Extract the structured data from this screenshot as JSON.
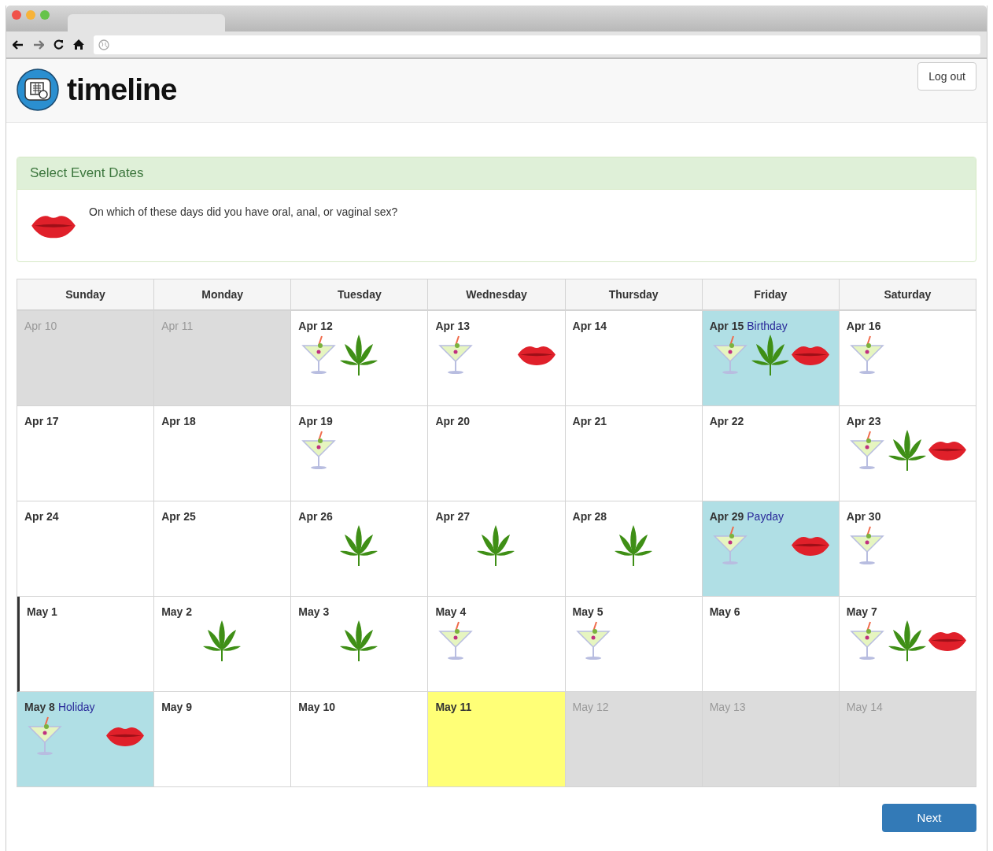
{
  "app": {
    "title": "timeline",
    "logout": "Log out"
  },
  "panel": {
    "title": "Select Event Dates",
    "question": "On which of these days did you have oral, anal, or vaginal sex?"
  },
  "calendar": {
    "days_of_week": [
      "Sunday",
      "Monday",
      "Tuesday",
      "Wednesday",
      "Thursday",
      "Friday",
      "Saturday"
    ],
    "weeks": [
      {
        "current": false,
        "days": [
          {
            "date": "Apr 10",
            "kind": "out",
            "drink": false,
            "weed": false,
            "lips": false
          },
          {
            "date": "Apr 11",
            "kind": "out",
            "drink": false,
            "weed": false,
            "lips": false
          },
          {
            "date": "Apr 12",
            "kind": "plain",
            "drink": true,
            "weed": true,
            "lips": false
          },
          {
            "date": "Apr 13",
            "kind": "plain",
            "drink": true,
            "weed": false,
            "lips": true
          },
          {
            "date": "Apr 14",
            "kind": "plain",
            "drink": false,
            "weed": false,
            "lips": false
          },
          {
            "date": "Apr 15",
            "note": "Birthday",
            "kind": "event",
            "drink": true,
            "weed": true,
            "lips": true
          },
          {
            "date": "Apr 16",
            "kind": "plain",
            "drink": true,
            "weed": false,
            "lips": false
          }
        ]
      },
      {
        "current": false,
        "days": [
          {
            "date": "Apr 17",
            "kind": "plain",
            "drink": false,
            "weed": false,
            "lips": false
          },
          {
            "date": "Apr 18",
            "kind": "plain",
            "drink": false,
            "weed": false,
            "lips": false
          },
          {
            "date": "Apr 19",
            "kind": "plain",
            "drink": true,
            "weed": false,
            "lips": false
          },
          {
            "date": "Apr 20",
            "kind": "plain",
            "drink": false,
            "weed": false,
            "lips": false
          },
          {
            "date": "Apr 21",
            "kind": "plain",
            "drink": false,
            "weed": false,
            "lips": false
          },
          {
            "date": "Apr 22",
            "kind": "plain",
            "drink": false,
            "weed": false,
            "lips": false
          },
          {
            "date": "Apr 23",
            "kind": "plain",
            "drink": true,
            "weed": true,
            "lips": true
          }
        ]
      },
      {
        "current": false,
        "days": [
          {
            "date": "Apr 24",
            "kind": "plain",
            "drink": false,
            "weed": false,
            "lips": false
          },
          {
            "date": "Apr 25",
            "kind": "plain",
            "drink": false,
            "weed": false,
            "lips": false
          },
          {
            "date": "Apr 26",
            "kind": "plain",
            "drink": false,
            "weed": true,
            "lips": false
          },
          {
            "date": "Apr 27",
            "kind": "plain",
            "drink": false,
            "weed": true,
            "lips": false
          },
          {
            "date": "Apr 28",
            "kind": "plain",
            "drink": false,
            "weed": true,
            "lips": false
          },
          {
            "date": "Apr 29",
            "note": "Payday",
            "kind": "event",
            "drink": true,
            "weed": false,
            "lips": true
          },
          {
            "date": "Apr 30",
            "kind": "plain",
            "drink": true,
            "weed": false,
            "lips": false
          }
        ]
      },
      {
        "current": true,
        "days": [
          {
            "date": "May 1",
            "kind": "plain",
            "drink": false,
            "weed": false,
            "lips": false
          },
          {
            "date": "May 2",
            "kind": "plain",
            "drink": false,
            "weed": true,
            "lips": false
          },
          {
            "date": "May 3",
            "kind": "plain",
            "drink": false,
            "weed": true,
            "lips": false
          },
          {
            "date": "May 4",
            "kind": "plain",
            "drink": true,
            "weed": false,
            "lips": false
          },
          {
            "date": "May 5",
            "kind": "plain",
            "drink": true,
            "weed": false,
            "lips": false
          },
          {
            "date": "May 6",
            "kind": "plain",
            "drink": false,
            "weed": false,
            "lips": false
          },
          {
            "date": "May 7",
            "kind": "plain",
            "drink": true,
            "weed": true,
            "lips": true
          }
        ]
      },
      {
        "current": false,
        "days": [
          {
            "date": "May 8",
            "note": "Holiday",
            "kind": "event",
            "drink": true,
            "weed": false,
            "lips": true
          },
          {
            "date": "May 9",
            "kind": "plain",
            "drink": false,
            "weed": false,
            "lips": false
          },
          {
            "date": "May 10",
            "kind": "plain",
            "drink": false,
            "weed": false,
            "lips": false
          },
          {
            "date": "May 11",
            "kind": "today",
            "drink": false,
            "weed": false,
            "lips": false
          },
          {
            "date": "May 12",
            "kind": "out",
            "drink": false,
            "weed": false,
            "lips": false
          },
          {
            "date": "May 13",
            "kind": "out",
            "drink": false,
            "weed": false,
            "lips": false
          },
          {
            "date": "May 14",
            "kind": "out",
            "drink": false,
            "weed": false,
            "lips": false
          }
        ]
      }
    ]
  },
  "next_button": "Next"
}
